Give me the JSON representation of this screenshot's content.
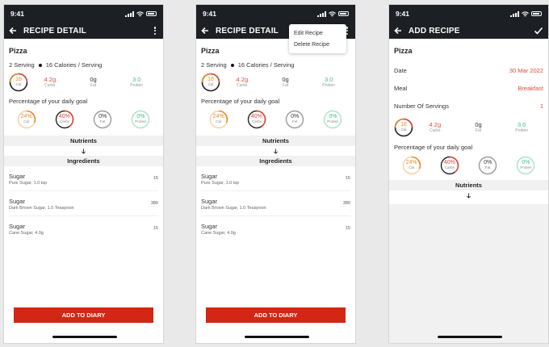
{
  "status": {
    "time": "9:41"
  },
  "screens": [
    {
      "title": "RECIPE DETAIL",
      "recipe_name": "Pizza",
      "servings": "2 Serving",
      "calories": "16 Calories / Serving",
      "ring": {
        "value": "16",
        "label": "Cal"
      },
      "macros": [
        {
          "value": "4.2g",
          "label": "Carbs"
        },
        {
          "value": "0g",
          "label": "Fat"
        },
        {
          "value": "3.0",
          "label": "Protien"
        }
      ],
      "goal_title": "Percentage of your daily goal",
      "goals": [
        {
          "value": "24%",
          "label": "Cal"
        },
        {
          "value": "40%",
          "label": "Carbs"
        },
        {
          "value": "0%",
          "label": "Fat"
        },
        {
          "value": "0%",
          "label": "Protien"
        }
      ],
      "nutrients_label": "Nutrients",
      "ingredients_label": "Ingredients",
      "ingredients": [
        {
          "name": "Sugar",
          "desc": "Pure Sugar, 1.0 tsp",
          "qty": "15"
        },
        {
          "name": "Sugar",
          "desc": "Dark Brown Sugar, 1.0 Teaspoon",
          "qty": "380"
        },
        {
          "name": "Sugar",
          "desc": "Cane Sugar, 4.0g",
          "qty": "15"
        }
      ],
      "add_button": "ADD TO DIARY"
    },
    {
      "title": "RECIPE DETAIL",
      "menu": [
        "Edit Recipe",
        "Delete Recipe"
      ],
      "recipe_name": "Pizza",
      "servings": "2 Serving",
      "calories": "16 Calories / Serving",
      "ring": {
        "value": "16",
        "label": "Cal"
      },
      "macros": [
        {
          "value": "4.2g",
          "label": "Carbs"
        },
        {
          "value": "0g",
          "label": "Fat"
        },
        {
          "value": "3.0",
          "label": "Protien"
        }
      ],
      "goal_title": "Percentage of your daily goal",
      "goals": [
        {
          "value": "24%",
          "label": "Cal"
        },
        {
          "value": "40%",
          "label": "Carbs"
        },
        {
          "value": "0%",
          "label": "Fat"
        },
        {
          "value": "0%",
          "label": "Protien"
        }
      ],
      "nutrients_label": "Nutrients",
      "ingredients_label": "Ingredients",
      "ingredients": [
        {
          "name": "Sugar",
          "desc": "Pure Sugar, 1.0 tsp",
          "qty": "15"
        },
        {
          "name": "Sugar",
          "desc": "Dark Brown Sugar, 1.0 Teaspoon",
          "qty": "380"
        },
        {
          "name": "Sugar",
          "desc": "Cane Sugar, 4.0g",
          "qty": "15"
        }
      ],
      "add_button": "ADD TO DIARY"
    },
    {
      "title": "ADD RECIPE",
      "recipe_name": "Pizza",
      "fields": [
        {
          "label": "Date",
          "value": "30 Mar 2022"
        },
        {
          "label": "Meal",
          "value": "Breakfast"
        },
        {
          "label": "Number Of Servings",
          "value": "1"
        }
      ],
      "ring": {
        "value": "16",
        "label": "Cal"
      },
      "macros": [
        {
          "value": "4.2g",
          "label": "Carbs"
        },
        {
          "value": "0g",
          "label": "Fat"
        },
        {
          "value": "3.0",
          "label": "Protien"
        }
      ],
      "goal_title": "Percentage of your daily goal",
      "goals": [
        {
          "value": "24%",
          "label": "Cal"
        },
        {
          "value": "40%",
          "label": "Carbs"
        },
        {
          "value": "0%",
          "label": "Fat"
        },
        {
          "value": "0%",
          "label": "Protien"
        }
      ],
      "nutrients_label": "Nutrients"
    }
  ],
  "colors": {
    "header": "#1c1f24",
    "accent_red": "#d32614",
    "cal_orange": "#e88a2a",
    "carbs_red": "#e04a3a",
    "protein_green": "#3fbe85"
  }
}
